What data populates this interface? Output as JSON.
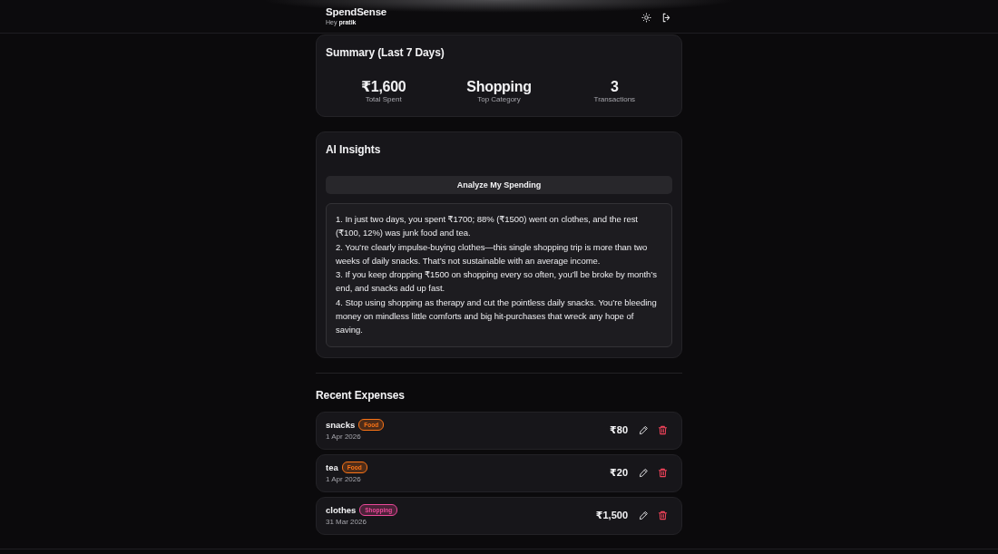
{
  "header": {
    "title": "SpendSense",
    "greeting": "Hey **pratik**"
  },
  "summary": {
    "title": "Summary (Last 7 Days)",
    "stats": [
      {
        "value": "₹1,600",
        "label": "Total Spent"
      },
      {
        "value": "Shopping",
        "label": "Top Category"
      },
      {
        "value": "3",
        "label": "Transactions"
      }
    ]
  },
  "insights": {
    "title": "AI Insights",
    "button": "Analyze My Spending",
    "lines": [
      "1. In just two days, you spent ₹1700; 88% (₹1500) went on clothes, and the rest (₹100, 12%) was junk food and tea.",
      "2. You’re clearly impulse-buying clothes—this single shopping trip is more than two weeks of daily snacks. That’s not sustainable with an average income.",
      "3. If you keep dropping ₹1500 on shopping every so often, you’ll be broke by month’s end, and snacks add up fast.",
      "4. Stop using shopping as therapy and cut the pointless daily snacks. You’re bleeding money on mindless little comforts and big hit-purchases that wreck any hope of saving."
    ]
  },
  "recent": {
    "title": "Recent Expenses",
    "items": [
      {
        "name": "snacks",
        "category": {
          "label": "Food",
          "color": "#f97316"
        },
        "date": "1 Apr 2026",
        "amount": "₹80"
      },
      {
        "name": "tea",
        "category": {
          "label": "Food",
          "color": "#f97316"
        },
        "date": "1 Apr 2026",
        "amount": "₹20"
      },
      {
        "name": "clothes",
        "category": {
          "label": "Shopping",
          "color": "#ec4899"
        },
        "date": "31 Mar 2026",
        "amount": "₹1,500"
      }
    ]
  }
}
